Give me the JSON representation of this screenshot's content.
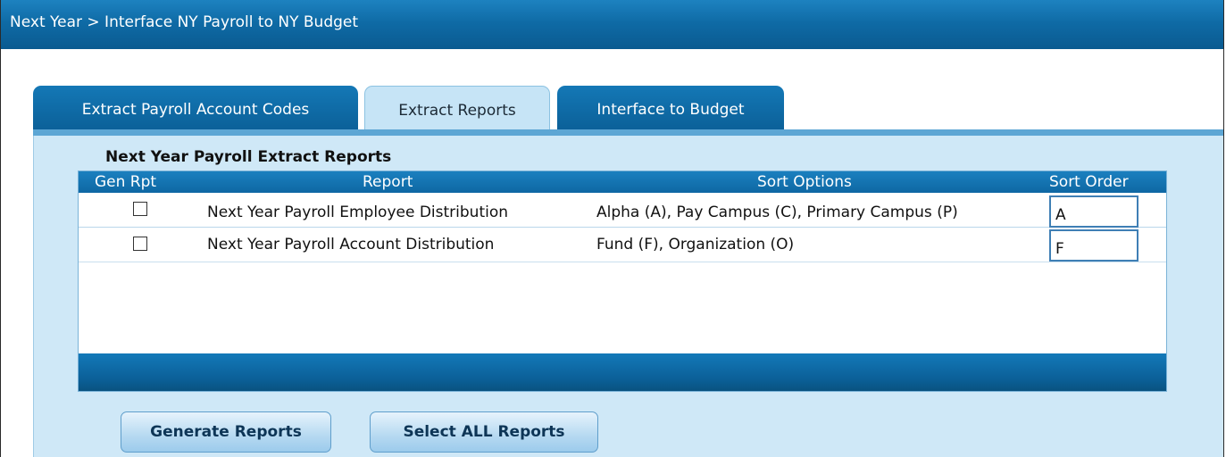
{
  "breadcrumb": "Next Year > Interface NY Payroll to NY Budget",
  "tabs": [
    {
      "label": "Extract Payroll Account Codes",
      "active": false
    },
    {
      "label": "Extract Reports",
      "active": true
    },
    {
      "label": "Interface to Budget",
      "active": false
    }
  ],
  "section": {
    "title": "Next Year Payroll Extract Reports"
  },
  "table": {
    "columns": [
      "Gen Rpt",
      "Report",
      "Sort Options",
      "Sort Order"
    ],
    "rows": [
      {
        "gen_rpt": false,
        "report": "Next Year Payroll Employee Distribution",
        "sort_options": "Alpha (A), Pay Campus (C), Primary Campus (P)",
        "sort_order": "A"
      },
      {
        "gen_rpt": false,
        "report": "Next Year Payroll Account Distribution",
        "sort_options": "Fund (F), Organization (O)",
        "sort_order": "F"
      }
    ]
  },
  "buttons": {
    "generate": "Generate Reports",
    "select_all": "Select ALL Reports"
  },
  "colors": {
    "header_blue": "#0f6ba6",
    "panel_blue": "#cfe8f7",
    "active_tab": "#c6e4f6"
  }
}
